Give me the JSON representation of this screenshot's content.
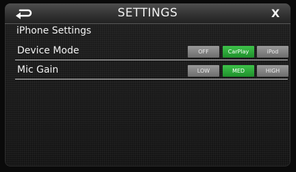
{
  "header": {
    "title": "SETTINGS",
    "back_icon": "back-arrow-icon",
    "close_label": "X"
  },
  "section": {
    "title": "iPhone Settings"
  },
  "rows": [
    {
      "label": "Device Mode",
      "options": [
        "OFF",
        "CarPlay",
        "iPod"
      ],
      "selected": "CarPlay"
    },
    {
      "label": "Mic Gain",
      "options": [
        "LOW",
        "MED",
        "HIGH"
      ],
      "selected": "MED"
    }
  ],
  "colors": {
    "active": "#2fae3b",
    "inactive": "#808080",
    "header": "#3a3a3a"
  }
}
